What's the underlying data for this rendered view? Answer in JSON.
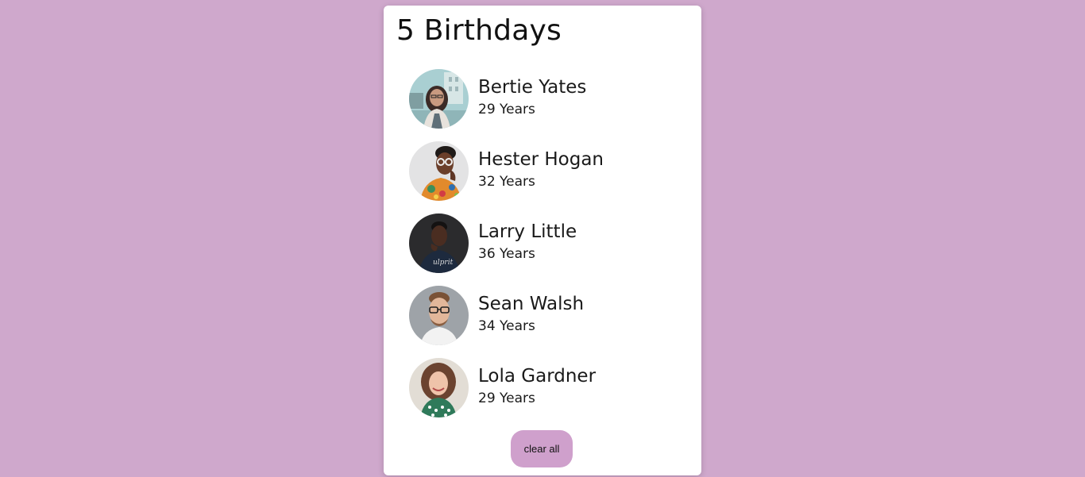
{
  "header": {
    "title": "5 Birthdays"
  },
  "people": [
    {
      "name": "Bertie Yates",
      "age": "29 Years",
      "avatar": "woman-street-photo"
    },
    {
      "name": "Hester Hogan",
      "age": "32 Years",
      "avatar": "woman-glasses-photo"
    },
    {
      "name": "Larry Little",
      "age": "36 Years",
      "avatar": "man-dark-tshirt-photo"
    },
    {
      "name": "Sean Walsh",
      "age": "34 Years",
      "avatar": "man-glasses-photo"
    },
    {
      "name": "Lola Gardner",
      "age": "29 Years",
      "avatar": "woman-curly-hair-photo"
    }
  ],
  "actions": {
    "clear_label": "clear all"
  },
  "colors": {
    "background": "#cfa8cc",
    "card": "#ffffff",
    "button": "#cfa0cc",
    "text": "#1a1a1a"
  }
}
